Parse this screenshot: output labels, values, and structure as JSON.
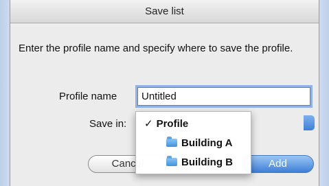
{
  "dialog": {
    "title": "Save list",
    "message": "Enter the profile name and specify where to save the profile."
  },
  "form": {
    "profile_name_label": "Profile name",
    "profile_name_value": "Untitled",
    "save_in_label": "Save in:"
  },
  "menu": {
    "items": [
      {
        "label": "Profile",
        "checked": true,
        "icon": "checkmark"
      },
      {
        "label": "Building A",
        "icon": "folder-icon"
      },
      {
        "label": "Building B",
        "icon": "folder-icon"
      }
    ]
  },
  "buttons": {
    "cancel": "Cancel",
    "add": "Add"
  }
}
